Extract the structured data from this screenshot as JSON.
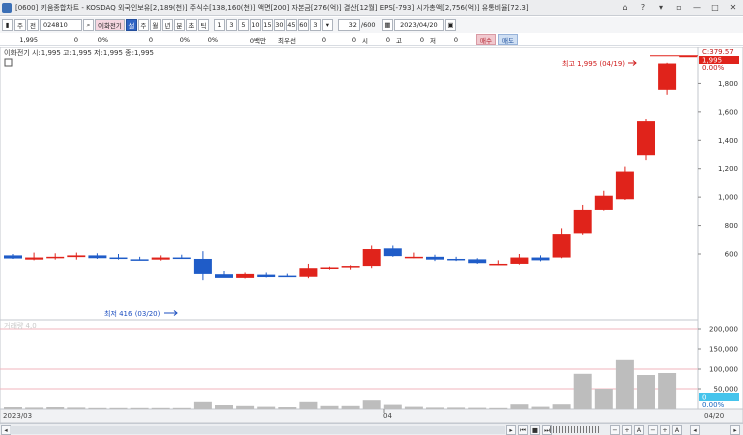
{
  "window": {
    "title": "[0600] 키움종합차트 - KOSDAQ 외국인보유[2,189(천)] 주식수[138,160(천)] 액면[200] 자본금[276(억)] 결산[12월] EPS[-793] 시가총액[2,756(억)] 유통비율[72.3]",
    "controls": [
      "⌂",
      "?",
      "▾",
      "▫",
      "—",
      "□",
      "✕"
    ]
  },
  "toolbar": {
    "mode_label": "주",
    "period_label": "전",
    "code_value": "024810",
    "search_icon": "magnifier",
    "name_value": "이화전기",
    "setting_label": "설",
    "tabs": [
      "주",
      "월",
      "년",
      "분",
      "초",
      "틱"
    ],
    "minutes": [
      "1",
      "3",
      "5",
      "10",
      "15",
      "30",
      "45",
      "60",
      "3"
    ],
    "count_value": "32",
    "count_max": "/600",
    "date_value": "2023/04/20"
  },
  "quote": {
    "price": "1,995",
    "change": "0",
    "change_pct": "0%",
    "volume": "0",
    "vol_pct": "0%",
    "vol_pct2": "0%",
    "amount": "0백만",
    "priority_label": "최우선",
    "prio_value": "0",
    "prio_value2": "0",
    "open_label": "시",
    "open_value": "0",
    "high_label": "고",
    "high_value": "0",
    "low_label": "저",
    "low_value": "0",
    "buy_label": "매수",
    "sell_label": "매도"
  },
  "chart": {
    "legend": "이화전기 시:1,995 고:1,995 저:1,995 종:1,995",
    "vol_legend": "거래량 4,0",
    "high_annotation": "최고 1,995 (04/19)",
    "low_annotation": "최저 416 (03/20)",
    "date_start": "2023/03",
    "date_mid": "04",
    "date_end": "04/20",
    "current_price_box": "1,995",
    "current_pct_box": "0.00%",
    "current_c_label": "C:379.57",
    "vol_current_box": "0",
    "vol_current_pct": "0.00%",
    "colors": {
      "up": "#e0231b",
      "down": "#1f5cc8",
      "volume": "#bdbdbd",
      "current_box": "#e0231b",
      "vol_box": "#46c4ec"
    }
  },
  "chart_data": [
    {
      "type": "candlestick",
      "title": "",
      "ylabel": "",
      "ylim": [
        416,
        1995
      ],
      "y_ticks": [
        "1,800",
        "1,600",
        "1,400",
        "1,200",
        "1,000",
        "800",
        "600"
      ],
      "candles": [
        {
          "o": 590,
          "h": 600,
          "l": 565,
          "c": 568
        },
        {
          "o": 560,
          "h": 610,
          "l": 555,
          "c": 575
        },
        {
          "o": 572,
          "h": 605,
          "l": 560,
          "c": 580
        },
        {
          "o": 578,
          "h": 610,
          "l": 560,
          "c": 590
        },
        {
          "o": 590,
          "h": 605,
          "l": 565,
          "c": 570
        },
        {
          "o": 575,
          "h": 600,
          "l": 560,
          "c": 566
        },
        {
          "o": 562,
          "h": 580,
          "l": 555,
          "c": 560
        },
        {
          "o": 560,
          "h": 590,
          "l": 553,
          "c": 575
        },
        {
          "o": 575,
          "h": 595,
          "l": 565,
          "c": 570
        },
        {
          "o": 565,
          "h": 620,
          "l": 416,
          "c": 460
        },
        {
          "o": 458,
          "h": 480,
          "l": 440,
          "c": 432
        },
        {
          "o": 432,
          "h": 470,
          "l": 428,
          "c": 460
        },
        {
          "o": 455,
          "h": 470,
          "l": 435,
          "c": 438
        },
        {
          "o": 448,
          "h": 462,
          "l": 440,
          "c": 442
        },
        {
          "o": 440,
          "h": 530,
          "l": 430,
          "c": 500
        },
        {
          "o": 495,
          "h": 510,
          "l": 490,
          "c": 505
        },
        {
          "o": 505,
          "h": 520,
          "l": 490,
          "c": 515
        },
        {
          "o": 515,
          "h": 660,
          "l": 500,
          "c": 635
        },
        {
          "o": 640,
          "h": 660,
          "l": 580,
          "c": 585
        },
        {
          "o": 580,
          "h": 610,
          "l": 570,
          "c": 580
        },
        {
          "o": 580,
          "h": 595,
          "l": 550,
          "c": 560
        },
        {
          "o": 565,
          "h": 580,
          "l": 550,
          "c": 556
        },
        {
          "o": 562,
          "h": 570,
          "l": 530,
          "c": 535
        },
        {
          "o": 528,
          "h": 555,
          "l": 520,
          "c": 530
        },
        {
          "o": 530,
          "h": 600,
          "l": 525,
          "c": 575
        },
        {
          "o": 575,
          "h": 590,
          "l": 548,
          "c": 555
        },
        {
          "o": 575,
          "h": 780,
          "l": 570,
          "c": 740
        },
        {
          "o": 745,
          "h": 945,
          "l": 735,
          "c": 910
        },
        {
          "o": 910,
          "h": 1045,
          "l": 905,
          "c": 1010
        },
        {
          "o": 985,
          "h": 1215,
          "l": 980,
          "c": 1180
        },
        {
          "o": 1295,
          "h": 1550,
          "l": 1260,
          "c": 1535
        },
        {
          "o": 1755,
          "h": 1945,
          "l": 1720,
          "c": 1940
        },
        {
          "o": 1995,
          "h": 1995,
          "l": 1995,
          "c": 1995
        }
      ]
    },
    {
      "type": "bar",
      "title": "",
      "ylim": [
        0,
        200000
      ],
      "y_ticks": [
        "200,000",
        "150,000",
        "100,000",
        "50,000"
      ],
      "values": [
        5000,
        4000,
        5000,
        4000,
        3000,
        3000,
        3000,
        3000,
        3000,
        18000,
        10000,
        8000,
        6000,
        5000,
        18000,
        8000,
        8000,
        22000,
        11000,
        6000,
        4000,
        4000,
        3500,
        3000,
        12000,
        6000,
        12000,
        88000,
        50000,
        123000,
        85000,
        90000,
        0
      ]
    }
  ]
}
